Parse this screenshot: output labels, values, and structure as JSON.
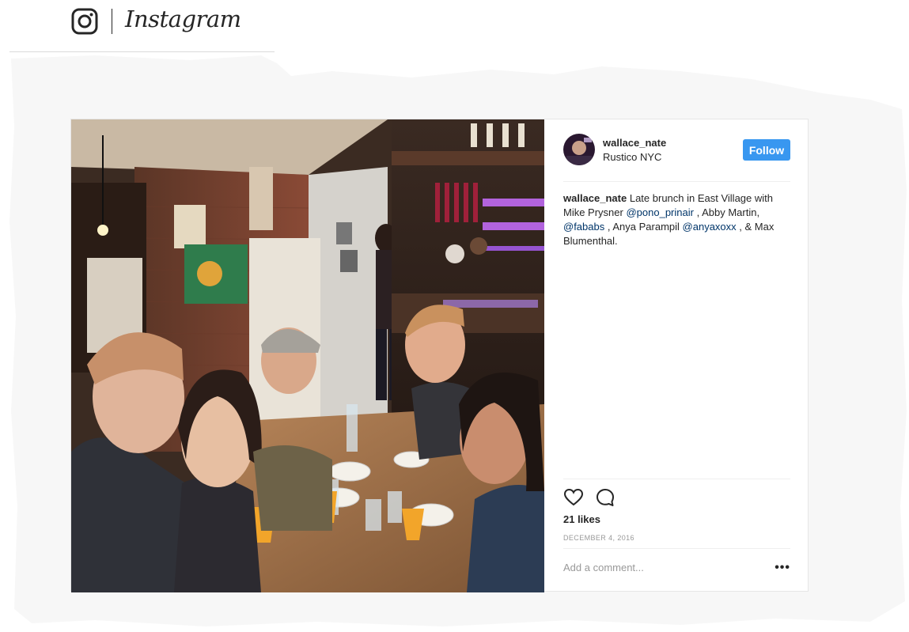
{
  "brand": {
    "wordmark": "Instagram",
    "logo_icon": "instagram-camera-icon"
  },
  "post": {
    "username": "wallace_nate",
    "location": "Rustico NYC",
    "follow_label": "Follow",
    "caption": {
      "user": "wallace_nate",
      "t1": "Late brunch in East Village with Mike Prysner",
      "m1": "@pono_prinair",
      "t2": ", Abby Martin,",
      "m2": "@fababs",
      "t3": ", Anya Parampil",
      "m3": "@anyaxoxx",
      "t4": ", & Max Blumenthal."
    },
    "like_icon": "heart-icon",
    "comment_icon": "comment-bubble-icon",
    "likes": "21 likes",
    "date": "DECEMBER 4, 2016",
    "comment_placeholder": "Add a comment...",
    "more_label": "•••"
  },
  "colors": {
    "accent": "#3897f0",
    "mention": "#003569",
    "muted": "#999999",
    "divider": "#efefef"
  }
}
